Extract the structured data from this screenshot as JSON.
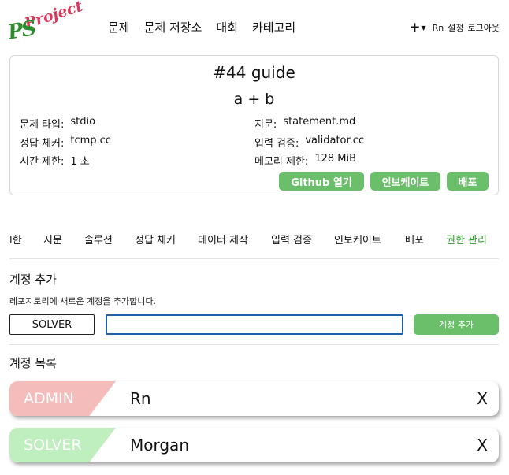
{
  "logo": {
    "top": "Project",
    "bottom": "PS"
  },
  "nav": {
    "items": [
      "문제",
      "문제 저장소",
      "대회",
      "카테고리"
    ]
  },
  "user": {
    "add_icon": "plus-icon",
    "name": "Rn",
    "settings": "설정",
    "logout": "로그아웃"
  },
  "problem": {
    "title": "#44 guide",
    "subtitle": "a + b",
    "fields": {
      "type_label": "문제 타입:",
      "type_value": "stdio",
      "checker_label": "정답 체커:",
      "checker_value": "tcmp.cc",
      "time_label": "시간 제한:",
      "time_value": "1 초",
      "statement_label": "지문:",
      "statement_value": "statement.md",
      "validator_label": "입력 검증:",
      "validator_value": "validator.cc",
      "memory_label": "메모리 제한:",
      "memory_value": "128 MiB"
    },
    "buttons": {
      "github": "Github 열기",
      "invoke": "인보케이트",
      "deploy": "배포"
    }
  },
  "tabs": {
    "items": [
      "l한",
      "지문",
      "솔루션",
      "정답 체커",
      "데이터 제작",
      "입력 검증",
      "인보케이트",
      "배포",
      "권한 관리"
    ],
    "active": "권한 관리",
    "active_color": "#2e9b2e"
  },
  "add_account": {
    "title": "계정 추가",
    "description": "레포지토리에 새로운 계정을 추가합니다.",
    "role_value": "SOLVER",
    "name_value": "",
    "button": "계정 추가"
  },
  "account_list": {
    "title": "계정 목록",
    "accounts": [
      {
        "role": "ADMIN",
        "name": "Rn",
        "remove": "X",
        "color": "#f5bcbc"
      },
      {
        "role": "SOLVER",
        "name": "Morgan",
        "remove": "X",
        "color": "#bfeebf"
      }
    ]
  },
  "colors": {
    "brand_green": "#6bbf6b",
    "input_border": "#1f5fa8"
  }
}
